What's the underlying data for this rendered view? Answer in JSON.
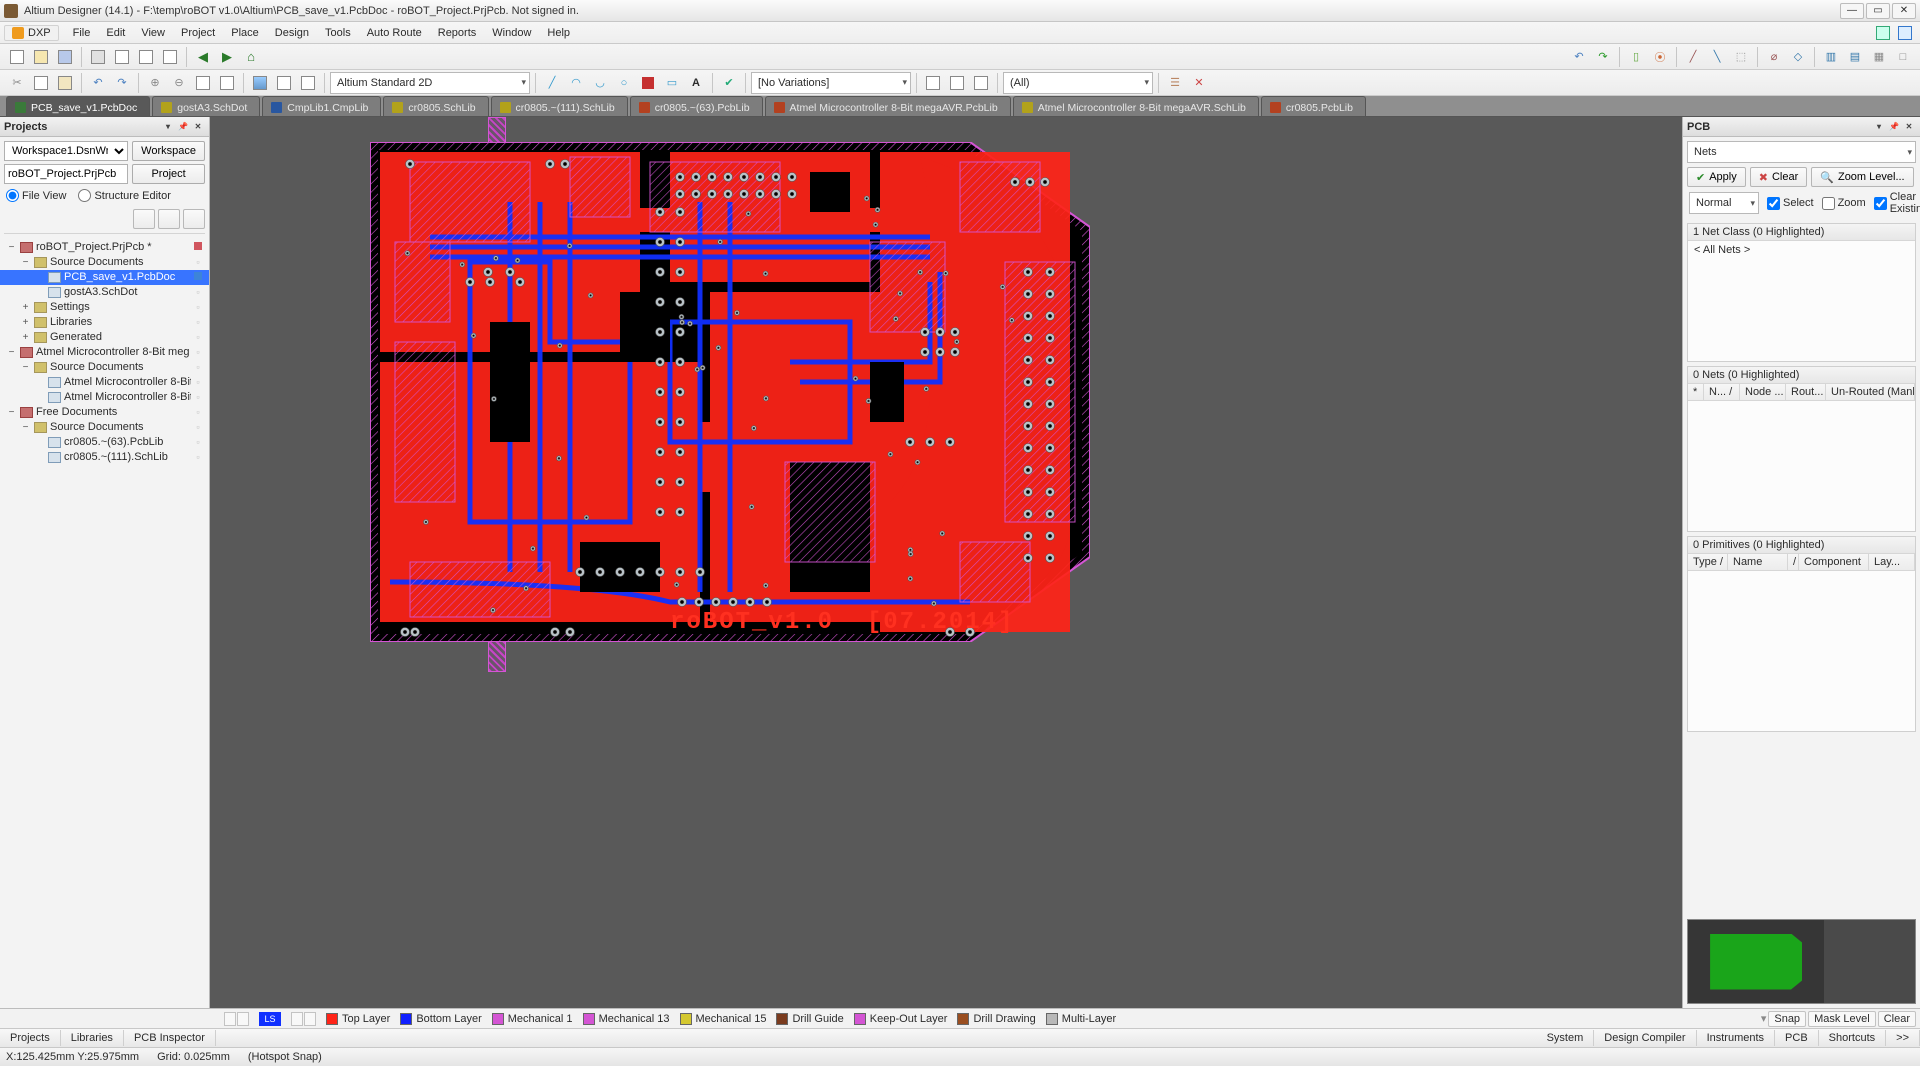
{
  "title": "Altium Designer (14.1) - F:\\temp\\roBOT v1.0\\Altium\\PCB_save_v1.PcbDoc - roBOT_Project.PrjPcb. Not signed in.",
  "menu": {
    "dxp": "DXP",
    "items": [
      "File",
      "Edit",
      "View",
      "Project",
      "Place",
      "Design",
      "Tools",
      "Auto Route",
      "Reports",
      "Window",
      "Help"
    ]
  },
  "toolbar2": {
    "viewmode": "Altium Standard 2D",
    "variation": "[No Variations]",
    "filter": "(All)"
  },
  "editorTabs": [
    {
      "label": "PCB_save_v1.PcbDoc",
      "cls": "active",
      "ico": "g"
    },
    {
      "label": "gostA3.SchDot",
      "cls": "",
      "ico": "y"
    },
    {
      "label": "CmpLib1.CmpLib",
      "cls": "",
      "ico": "b"
    },
    {
      "label": "cr0805.SchLib",
      "cls": "",
      "ico": "y"
    },
    {
      "label": "cr0805.~(111).SchLib",
      "cls": "",
      "ico": "y"
    },
    {
      "label": "cr0805.~(63).PcbLib",
      "cls": "",
      "ico": "r"
    },
    {
      "label": "Atmel Microcontroller 8-Bit megaAVR.PcbLib",
      "cls": "",
      "ico": "r"
    },
    {
      "label": "Atmel Microcontroller 8-Bit megaAVR.SchLib",
      "cls": "",
      "ico": "y"
    },
    {
      "label": "cr0805.PcbLib",
      "cls": "",
      "ico": "r"
    }
  ],
  "projectsPanel": {
    "title": "Projects",
    "workspace": "Workspace1.DsnWrk",
    "workspaceBtn": "Workspace",
    "project": "roBOT_Project.PrjPcb",
    "projectBtn": "Project",
    "fileView": "File View",
    "structEditor": "Structure Editor",
    "tree": [
      {
        "d": 0,
        "tw": "−",
        "ico": "proj",
        "label": "roBOT_Project.PrjPcb *",
        "mark": "#d0555e"
      },
      {
        "d": 1,
        "tw": "−",
        "ico": "fold",
        "label": "Source Documents",
        "mark": ""
      },
      {
        "d": 2,
        "tw": "",
        "ico": "file",
        "label": "PCB_save_v1.PcbDoc",
        "mark": "#3d84d8",
        "sel": true
      },
      {
        "d": 2,
        "tw": "",
        "ico": "file",
        "label": "gostA3.SchDot",
        "mark": ""
      },
      {
        "d": 1,
        "tw": "+",
        "ico": "fold",
        "label": "Settings",
        "mark": ""
      },
      {
        "d": 1,
        "tw": "+",
        "ico": "fold",
        "label": "Libraries",
        "mark": ""
      },
      {
        "d": 1,
        "tw": "+",
        "ico": "fold",
        "label": "Generated",
        "mark": ""
      },
      {
        "d": 0,
        "tw": "−",
        "ico": "proj",
        "label": "Atmel Microcontroller 8-Bit meg",
        "mark": ""
      },
      {
        "d": 1,
        "tw": "−",
        "ico": "fold",
        "label": "Source Documents",
        "mark": ""
      },
      {
        "d": 2,
        "tw": "",
        "ico": "file",
        "label": "Atmel Microcontroller 8-Bit",
        "mark": ""
      },
      {
        "d": 2,
        "tw": "",
        "ico": "file",
        "label": "Atmel Microcontroller 8-Bit",
        "mark": ""
      },
      {
        "d": 0,
        "tw": "−",
        "ico": "proj",
        "label": "Free Documents",
        "mark": ""
      },
      {
        "d": 1,
        "tw": "−",
        "ico": "fold",
        "label": "Source Documents",
        "mark": ""
      },
      {
        "d": 2,
        "tw": "",
        "ico": "file",
        "label": "cr0805.~(63).PcbLib",
        "mark": ""
      },
      {
        "d": 2,
        "tw": "",
        "ico": "file",
        "label": "cr0805.~(111).SchLib",
        "mark": ""
      }
    ]
  },
  "layerTabs": [
    {
      "label": "Top Layer",
      "color": "#ff2418"
    },
    {
      "label": "Bottom Layer",
      "color": "#1020ff"
    },
    {
      "label": "Mechanical 1",
      "color": "#d455d4"
    },
    {
      "label": "Mechanical 13",
      "color": "#d455d4"
    },
    {
      "label": "Mechanical 15",
      "color": "#d4c830"
    },
    {
      "label": "Drill Guide",
      "color": "#7a3b1e"
    },
    {
      "label": "Keep-Out Layer",
      "color": "#d455d4"
    },
    {
      "label": "Drill Drawing",
      "color": "#9a4e20"
    },
    {
      "label": "Multi-Layer",
      "color": "#b8b8b8"
    }
  ],
  "layerMini": {
    "ls": "LS",
    "snap": "Snap",
    "mask": "Mask Level",
    "clear": "Clear"
  },
  "pcbPanel": {
    "title": "PCB",
    "mode": "Nets",
    "apply": "Apply",
    "clear": "Clear",
    "zoom": "Zoom Level...",
    "normal": "Normal",
    "opts": {
      "select": "Select",
      "zoomChk": "Zoom",
      "clearEx": "Clear Existing"
    },
    "netClass": {
      "header": "1 Net Class (0 Highlighted)",
      "row": "< All Nets >"
    },
    "nets": {
      "header": "0 Nets (0 Highlighted)",
      "cols": [
        "*",
        "N... /",
        "Node ...",
        "Rout...",
        "Un-Routed (Manhatta..."
      ]
    },
    "prims": {
      "header": "0 Primitives (0 Highlighted)",
      "cols": [
        "Type /",
        "Name",
        "/",
        "Component",
        "Lay..."
      ]
    }
  },
  "bottomTabs": {
    "left": [
      "Projects",
      "Libraries",
      "PCB Inspector"
    ],
    "right": [
      "System",
      "Design Compiler",
      "Instruments",
      "PCB",
      "Shortcuts",
      ">>"
    ]
  },
  "status": {
    "coords": "X:125.425mm Y:25.975mm",
    "grid": "Grid: 0.025mm",
    "snap": "(Hotspot Snap)"
  },
  "silk": {
    "name": "roBOT_v1.0",
    "date": "[07.2014]"
  }
}
